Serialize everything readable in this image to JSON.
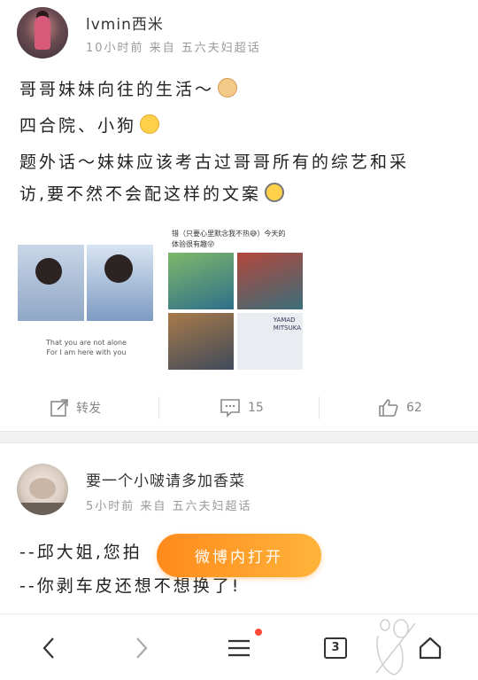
{
  "post1": {
    "username": "lvmin西米",
    "meta": "10小时前 来自 五六夫妇超话",
    "lines": [
      "哥哥妹妹向往的生活～",
      "四合院、小狗",
      "题外话～妹妹应该考古过哥哥所有的综艺和采",
      "访,要不然不会配这样的文案"
    ],
    "emojis": [
      "cat-face-icon",
      "thinking-face-icon",
      "nerd-glasses-icon"
    ],
    "images": {
      "left_caption": "That you are not alone\nFor I am here with you",
      "right_header": "错（只要心里默念我不热😅）今天的\n体验很有趣😜",
      "right_sign": "YAMAD\nMITSUKA"
    },
    "actions": {
      "repost_label": "转发",
      "comment_count": "15",
      "like_count": "62"
    }
  },
  "post2": {
    "username": "要一个小啵请多加香菜",
    "meta": "5小时前 来自 五六夫妇超话",
    "lines": [
      "--邱大姐,您拍",
      "--你剥车皮还想不想换了!"
    ]
  },
  "open_app_label": "微博内打开",
  "nav": {
    "tab_count": "3",
    "icons": [
      "back-arrow-icon",
      "forward-arrow-icon",
      "menu-icon",
      "tabs-icon",
      "home-icon"
    ]
  },
  "colors": {
    "accent": "#ff8a1c",
    "badge": "#ff4a3a",
    "meta_text": "#999999"
  }
}
